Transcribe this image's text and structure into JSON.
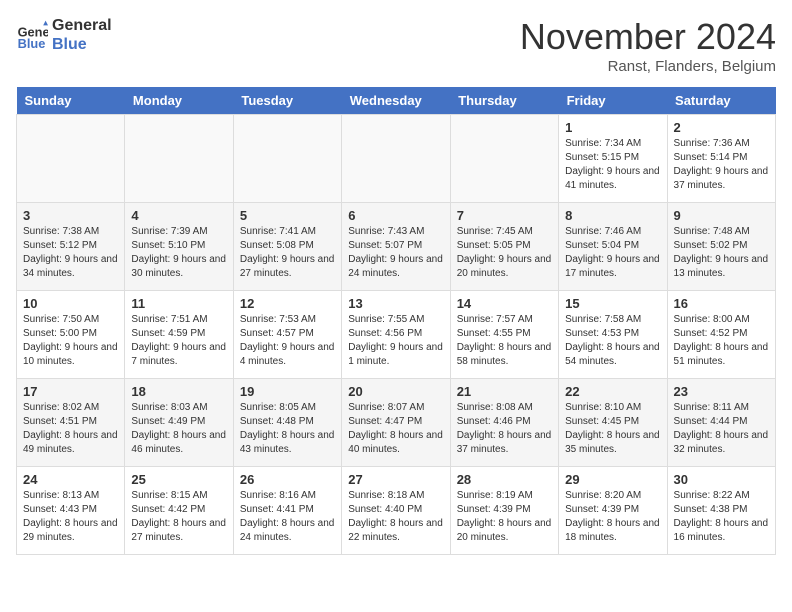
{
  "logo": {
    "line1": "General",
    "line2": "Blue"
  },
  "title": "November 2024",
  "subtitle": "Ranst, Flanders, Belgium",
  "days_of_week": [
    "Sunday",
    "Monday",
    "Tuesday",
    "Wednesday",
    "Thursday",
    "Friday",
    "Saturday"
  ],
  "weeks": [
    [
      {
        "day": "",
        "info": ""
      },
      {
        "day": "",
        "info": ""
      },
      {
        "day": "",
        "info": ""
      },
      {
        "day": "",
        "info": ""
      },
      {
        "day": "",
        "info": ""
      },
      {
        "day": "1",
        "info": "Sunrise: 7:34 AM\nSunset: 5:15 PM\nDaylight: 9 hours and 41 minutes."
      },
      {
        "day": "2",
        "info": "Sunrise: 7:36 AM\nSunset: 5:14 PM\nDaylight: 9 hours and 37 minutes."
      }
    ],
    [
      {
        "day": "3",
        "info": "Sunrise: 7:38 AM\nSunset: 5:12 PM\nDaylight: 9 hours and 34 minutes."
      },
      {
        "day": "4",
        "info": "Sunrise: 7:39 AM\nSunset: 5:10 PM\nDaylight: 9 hours and 30 minutes."
      },
      {
        "day": "5",
        "info": "Sunrise: 7:41 AM\nSunset: 5:08 PM\nDaylight: 9 hours and 27 minutes."
      },
      {
        "day": "6",
        "info": "Sunrise: 7:43 AM\nSunset: 5:07 PM\nDaylight: 9 hours and 24 minutes."
      },
      {
        "day": "7",
        "info": "Sunrise: 7:45 AM\nSunset: 5:05 PM\nDaylight: 9 hours and 20 minutes."
      },
      {
        "day": "8",
        "info": "Sunrise: 7:46 AM\nSunset: 5:04 PM\nDaylight: 9 hours and 17 minutes."
      },
      {
        "day": "9",
        "info": "Sunrise: 7:48 AM\nSunset: 5:02 PM\nDaylight: 9 hours and 13 minutes."
      }
    ],
    [
      {
        "day": "10",
        "info": "Sunrise: 7:50 AM\nSunset: 5:00 PM\nDaylight: 9 hours and 10 minutes."
      },
      {
        "day": "11",
        "info": "Sunrise: 7:51 AM\nSunset: 4:59 PM\nDaylight: 9 hours and 7 minutes."
      },
      {
        "day": "12",
        "info": "Sunrise: 7:53 AM\nSunset: 4:57 PM\nDaylight: 9 hours and 4 minutes."
      },
      {
        "day": "13",
        "info": "Sunrise: 7:55 AM\nSunset: 4:56 PM\nDaylight: 9 hours and 1 minute."
      },
      {
        "day": "14",
        "info": "Sunrise: 7:57 AM\nSunset: 4:55 PM\nDaylight: 8 hours and 58 minutes."
      },
      {
        "day": "15",
        "info": "Sunrise: 7:58 AM\nSunset: 4:53 PM\nDaylight: 8 hours and 54 minutes."
      },
      {
        "day": "16",
        "info": "Sunrise: 8:00 AM\nSunset: 4:52 PM\nDaylight: 8 hours and 51 minutes."
      }
    ],
    [
      {
        "day": "17",
        "info": "Sunrise: 8:02 AM\nSunset: 4:51 PM\nDaylight: 8 hours and 49 minutes."
      },
      {
        "day": "18",
        "info": "Sunrise: 8:03 AM\nSunset: 4:49 PM\nDaylight: 8 hours and 46 minutes."
      },
      {
        "day": "19",
        "info": "Sunrise: 8:05 AM\nSunset: 4:48 PM\nDaylight: 8 hours and 43 minutes."
      },
      {
        "day": "20",
        "info": "Sunrise: 8:07 AM\nSunset: 4:47 PM\nDaylight: 8 hours and 40 minutes."
      },
      {
        "day": "21",
        "info": "Sunrise: 8:08 AM\nSunset: 4:46 PM\nDaylight: 8 hours and 37 minutes."
      },
      {
        "day": "22",
        "info": "Sunrise: 8:10 AM\nSunset: 4:45 PM\nDaylight: 8 hours and 35 minutes."
      },
      {
        "day": "23",
        "info": "Sunrise: 8:11 AM\nSunset: 4:44 PM\nDaylight: 8 hours and 32 minutes."
      }
    ],
    [
      {
        "day": "24",
        "info": "Sunrise: 8:13 AM\nSunset: 4:43 PM\nDaylight: 8 hours and 29 minutes."
      },
      {
        "day": "25",
        "info": "Sunrise: 8:15 AM\nSunset: 4:42 PM\nDaylight: 8 hours and 27 minutes."
      },
      {
        "day": "26",
        "info": "Sunrise: 8:16 AM\nSunset: 4:41 PM\nDaylight: 8 hours and 24 minutes."
      },
      {
        "day": "27",
        "info": "Sunrise: 8:18 AM\nSunset: 4:40 PM\nDaylight: 8 hours and 22 minutes."
      },
      {
        "day": "28",
        "info": "Sunrise: 8:19 AM\nSunset: 4:39 PM\nDaylight: 8 hours and 20 minutes."
      },
      {
        "day": "29",
        "info": "Sunrise: 8:20 AM\nSunset: 4:39 PM\nDaylight: 8 hours and 18 minutes."
      },
      {
        "day": "30",
        "info": "Sunrise: 8:22 AM\nSunset: 4:38 PM\nDaylight: 8 hours and 16 minutes."
      }
    ]
  ]
}
